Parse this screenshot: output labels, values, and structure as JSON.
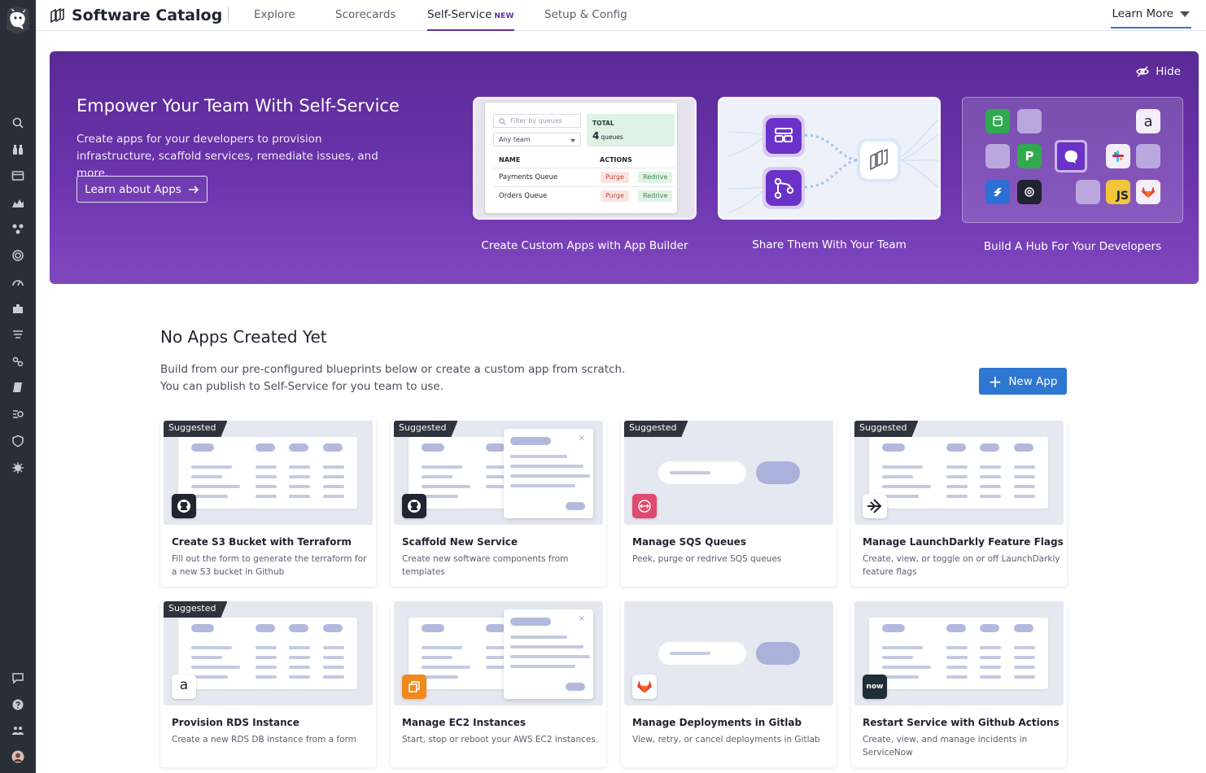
{
  "topbar": {
    "title": "Software Catalog",
    "tabs": [
      {
        "label": "Explore"
      },
      {
        "label": "Scorecards"
      },
      {
        "label": "Self-Service",
        "badge": "NEW"
      },
      {
        "label": "Setup & Config"
      }
    ],
    "learn_more": "Learn More"
  },
  "hero": {
    "title": "Empower Your Team With Self-Service",
    "description": "Create apps for your developers to provision infrastructure, scaffold services, remediate issues, and more.",
    "button": "Learn about Apps",
    "hide": "Hide",
    "cards": [
      {
        "caption": "Create Custom Apps with App Builder"
      },
      {
        "caption": "Share Them With Your Team"
      },
      {
        "caption": "Build A Hub For Your Developers"
      }
    ],
    "mock": {
      "filter_placeholder": "Filter by queues",
      "team": "Any team",
      "total_label": "TOTAL",
      "total_value": "4",
      "total_unit": "queues",
      "col_name": "NAME",
      "col_actions": "ACTIONS",
      "rows": [
        {
          "name": "Payments Queue",
          "a1": "Purge",
          "a2": "Redrive"
        },
        {
          "name": "Orders Queue",
          "a1": "Purge",
          "a2": "Redrive"
        }
      ]
    },
    "hub_tiles": {
      "p": "P",
      "js": "JS",
      "a": "a"
    }
  },
  "main": {
    "title": "No Apps Created Yet",
    "description_line1": "Build from our pre-configured blueprints below or create a custom app from scratch.",
    "description_line2": "You can publish to Self-Service for you team to use.",
    "new_app": "New App"
  },
  "blueprints": [
    {
      "badge": "Suggested",
      "title": "Create S3 Bucket with Terraform",
      "desc": "Fill out the form to generate the terraform for a new S3 bucket in Github",
      "logo": "github-icon"
    },
    {
      "badge": "Suggested",
      "title": "Scaffold New Service",
      "desc": "Create new software components from templates",
      "logo": "github-icon"
    },
    {
      "badge": "Suggested",
      "title": "Manage SQS Queues",
      "desc": "Peek, purge or redrive SQS queues",
      "logo": "sqs-icon"
    },
    {
      "badge": "Suggested",
      "title": "Manage LaunchDarkly Feature Flags",
      "desc": "Create, view, or toggle on or off LaunchDarkly feature flags",
      "logo": "launchdarkly-icon"
    },
    {
      "badge": "Suggested",
      "title": "Provision RDS Instance",
      "desc": "Create a new RDS DB instance from a form",
      "logo": "amazon-icon",
      "logo_text": "a"
    },
    {
      "badge": "",
      "title": "Manage EC2 Instances",
      "desc": "Start, stop or reboot your AWS EC2 instances.",
      "logo": "ec2-icon"
    },
    {
      "badge": "",
      "title": "Manage Deployments in Gitlab",
      "desc": "View, retry, or cancel deployments in Gitlab",
      "logo": "gitlab-icon"
    },
    {
      "badge": "",
      "title": "Restart Service with Github Actions",
      "desc": "Create, view, and manage incidents in ServiceNow",
      "logo": "servicenow-icon",
      "logo_text": "now"
    }
  ],
  "colors": {
    "accent": "#632ca6",
    "primary_button": "#2e77d0",
    "nav_bg": "#2a2e36"
  }
}
